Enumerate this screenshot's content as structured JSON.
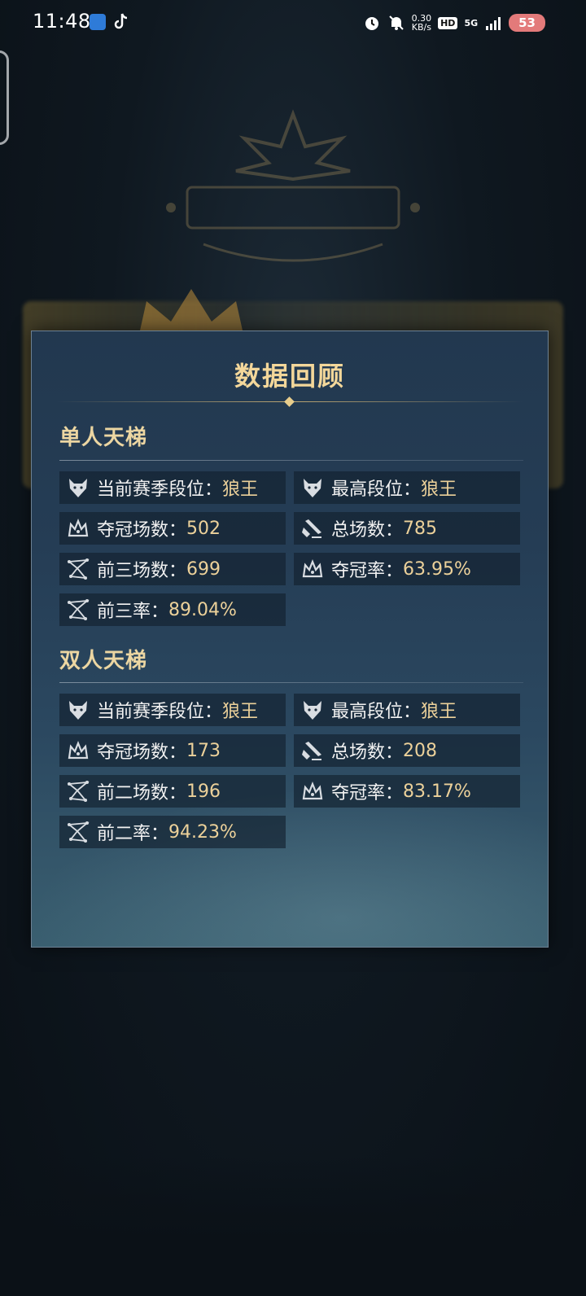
{
  "status_bar": {
    "time": "11:48",
    "net_speed_value": "0.30",
    "net_speed_unit": "KB/s",
    "hd_label": "HD",
    "network_label": "5G",
    "battery": "53",
    "icons": [
      "alarm-icon",
      "mute-bell-icon",
      "signal-icon",
      "battery-icon"
    ]
  },
  "panel": {
    "title": "数据回顾",
    "sections": [
      {
        "title": "单人天梯",
        "stats": [
          {
            "label": "当前赛季段位：",
            "value": "狼王",
            "icon": "wolf-icon"
          },
          {
            "label": "最高段位：",
            "value": "狼王",
            "icon": "wolf-icon"
          },
          {
            "label": "夺冠场数：",
            "value": "502",
            "icon": "crown-icon"
          },
          {
            "label": "总场数：",
            "value": "785",
            "icon": "scroll-icon"
          },
          {
            "label": "前三场数：",
            "value": "699",
            "icon": "constellation-icon"
          },
          {
            "label": "夺冠率：",
            "value": "63.95%",
            "icon": "crown-icon"
          },
          {
            "label": "前三率：",
            "value": "89.04%",
            "icon": "constellation-icon"
          }
        ]
      },
      {
        "title": "双人天梯",
        "stats": [
          {
            "label": "当前赛季段位：",
            "value": "狼王",
            "icon": "wolf-icon"
          },
          {
            "label": "最高段位：",
            "value": "狼王",
            "icon": "wolf-icon"
          },
          {
            "label": "夺冠场数：",
            "value": "173",
            "icon": "crown-icon"
          },
          {
            "label": "总场数：",
            "value": "208",
            "icon": "scroll-icon"
          },
          {
            "label": "前二场数：",
            "value": "196",
            "icon": "constellation-icon"
          },
          {
            "label": "夺冠率：",
            "value": "83.17%",
            "icon": "crown-icon"
          },
          {
            "label": "前二率：",
            "value": "94.23%",
            "icon": "constellation-icon"
          }
        ]
      }
    ]
  },
  "colors": {
    "accent_gold": "#ecd19a",
    "panel_bg": "#253d55",
    "battery": "#e37a7a"
  }
}
